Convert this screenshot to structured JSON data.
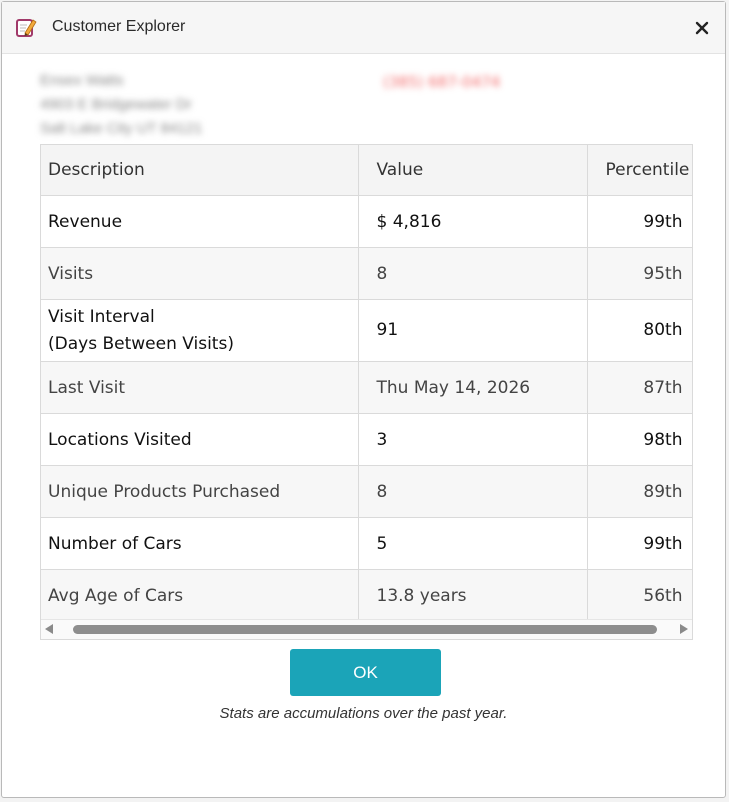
{
  "window": {
    "title": "Customer Explorer"
  },
  "contact": {
    "name": "Ensex Watts",
    "address": "4903 E Bridgewater Dr",
    "city": "Salt Lake City UT 84121",
    "phone": "(385) 687-0474"
  },
  "table": {
    "headers": [
      "Description",
      "Value",
      "Percentile"
    ],
    "rows": [
      {
        "description": "Revenue",
        "value": "$ 4,816",
        "percentile": "99th"
      },
      {
        "description": "Visits",
        "value": "8",
        "percentile": "95th"
      },
      {
        "description": "Visit Interval",
        "description2": "(Days Between Visits)",
        "value": "91",
        "percentile": "80th"
      },
      {
        "description": "Last Visit",
        "value": "Thu May 14, 2026",
        "percentile": "87th"
      },
      {
        "description": "Locations Visited",
        "value": "3",
        "percentile": "98th"
      },
      {
        "description": "Unique Products Purchased",
        "value": "8",
        "percentile": "89th"
      },
      {
        "description": "Number of Cars",
        "value": "5",
        "percentile": "99th"
      },
      {
        "description": "Avg Age of Cars",
        "value": "13.8 years",
        "percentile": "56th"
      }
    ]
  },
  "buttons": {
    "ok": "OK"
  },
  "footer": {
    "note": "Stats are accumulations over the past year."
  },
  "colors": {
    "accent": "#1ba4b8"
  }
}
